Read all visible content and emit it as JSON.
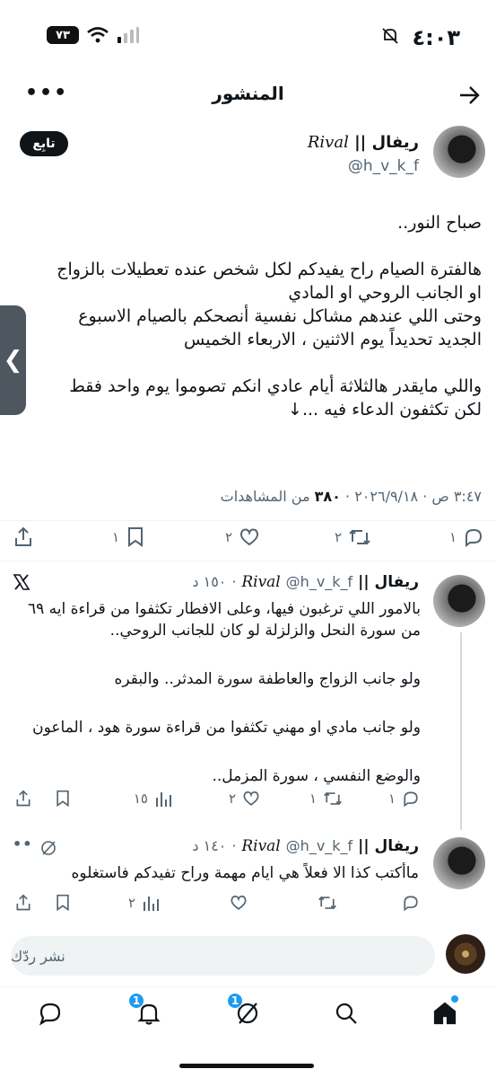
{
  "status_bar": {
    "time": "٤:٠٣",
    "battery": "٧٣"
  },
  "header": {
    "title": "المنشور"
  },
  "tweet": {
    "display_name_ar": "ريفال",
    "display_name_sep": "||",
    "display_name_latin": "Rival",
    "handle": "@h_v_k_f",
    "follow_label": "تابِع",
    "lines": [
      "صباح النور..",
      "",
      "هالفترة الصيام راح يفيدكم لكل شخص عنده تعطيلات بالزواج",
      "او الجانب الروحي او المادي",
      "وحتى اللي عندهم مشاكل نفسية أنصحكم بالصيام الاسبوع",
      "الجديد تحديداً يوم الاثنين ، الاربعاء الخميس",
      "",
      "واللي مايقدر هالثلاثة أيام عادي انكم تصوموا يوم واحد فقط",
      "لكن تكثفون الدعاء فيه ...↓"
    ],
    "time": "٣:٤٧ ص",
    "date": "٢٠٢٦/٩/١٨",
    "views_count": "٣٨٠",
    "views_label": "من المشاهدات",
    "actions": {
      "replies": "١",
      "retweets": "٢",
      "likes": "٢",
      "bookmarks": "١"
    }
  },
  "replies": [
    {
      "display_name_ar": "ريفال",
      "display_name_sep": "||",
      "display_name_latin": "Rival",
      "handle": "@h_v_k_f",
      "age": "١٥٠ د",
      "lines": [
        "بالامور اللي ترغبون فيها، وعلى الافطار تكثفوا من قراءة ايه ٦٩",
        "من سورة النحل والزلزلة لو كان للجانب الروحي..",
        "",
        "ولو جانب الزواج والعاطفة سورة المدثر.. والبقره",
        "",
        "ولو جانب مادي او مهني تكثفوا من قراءة سورة هود ، الماعون",
        "",
        "والوضع النفسي ، سورة المزمل.."
      ],
      "actions": {
        "replies": "١",
        "retweets": "١",
        "likes": "٢",
        "views": "١٥"
      }
    },
    {
      "display_name_ar": "ريفال",
      "display_name_sep": "||",
      "display_name_latin": "Rival",
      "handle": "@h_v_k_f",
      "age": "١٤٠ د",
      "lines": [
        "ماأكتب كذا الا فعلاً هي ايام مهمة وراح تفيدكم فاستغلوه"
      ],
      "actions": {
        "views": "٢"
      }
    }
  ],
  "compose": {
    "placeholder": "نشر ردّك"
  },
  "nav": {
    "notifications_badge": "1",
    "grok_badge": "1"
  },
  "colors": {
    "accent": "#1d9bf0",
    "text": "#0f1419",
    "muted": "#536471"
  }
}
